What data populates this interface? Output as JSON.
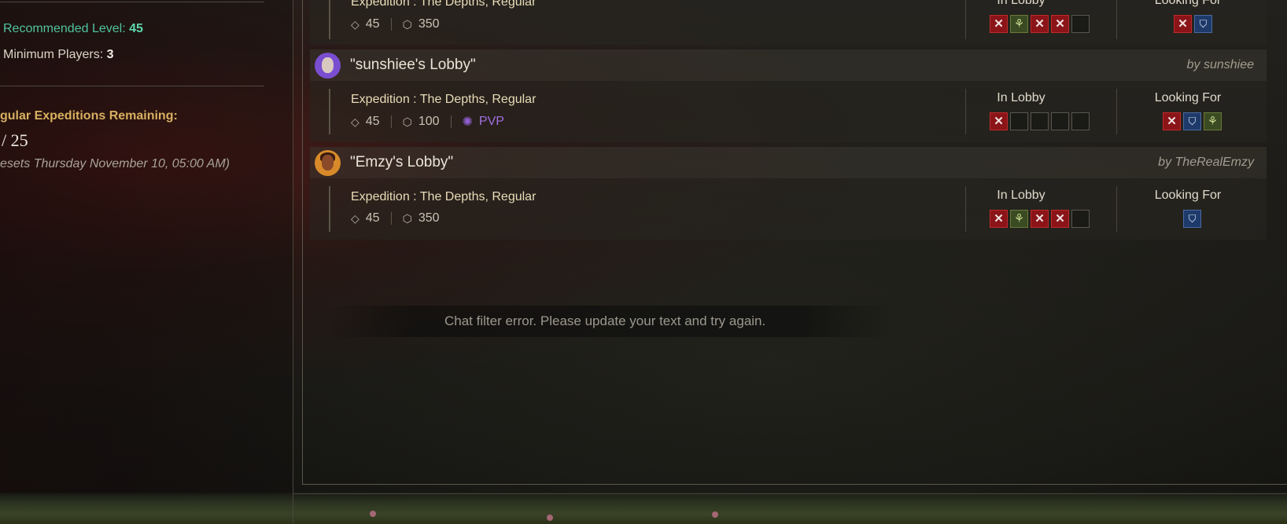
{
  "sidebar": {
    "recommended_label": "Recommended Level: ",
    "recommended_value": "45",
    "min_players_label": "Minimum Players: ",
    "min_players_value": "3",
    "remaining_title": "gular Expeditions Remaining:",
    "remaining_count": "/ 25",
    "resets_text": "esets Thursday November 10, 05:00 AM)"
  },
  "columns": {
    "in_lobby": "In Lobby",
    "looking_for": "Looking For"
  },
  "lobbies": [
    {
      "name": "",
      "owner": "",
      "expedition": "Expedition : The Depths, Regular",
      "level": "45",
      "gear_score": "350",
      "pvp": "",
      "in_lobby": [
        "dps",
        "heal",
        "dps",
        "dps",
        "empty"
      ],
      "looking_for": [
        "dps",
        "tank"
      ]
    },
    {
      "name": "\"sunshiee's Lobby\"",
      "owner": "by sunshiee",
      "expedition": "Expedition : The Depths, Regular",
      "level": "45",
      "gear_score": "100",
      "pvp": "PVP",
      "in_lobby": [
        "dps",
        "empty",
        "empty",
        "empty",
        "empty"
      ],
      "looking_for": [
        "dps",
        "tank",
        "heal"
      ]
    },
    {
      "name": "\"Emzy's Lobby\"",
      "owner": "by TheRealEmzy",
      "expedition": "Expedition : The Depths, Regular",
      "level": "45",
      "gear_score": "350",
      "pvp": "",
      "in_lobby": [
        "dps",
        "heal",
        "dps",
        "dps",
        "empty"
      ],
      "looking_for": [
        "tank"
      ]
    }
  ],
  "toast": {
    "message": "Chat filter error. Please update your text and try again."
  },
  "icons": {
    "level": "diamond-icon",
    "gear": "gear-score-icon",
    "pvp": "pvp-icon",
    "dps": "crossed-swords-icon",
    "heal": "healer-icon",
    "tank": "shield-icon"
  }
}
